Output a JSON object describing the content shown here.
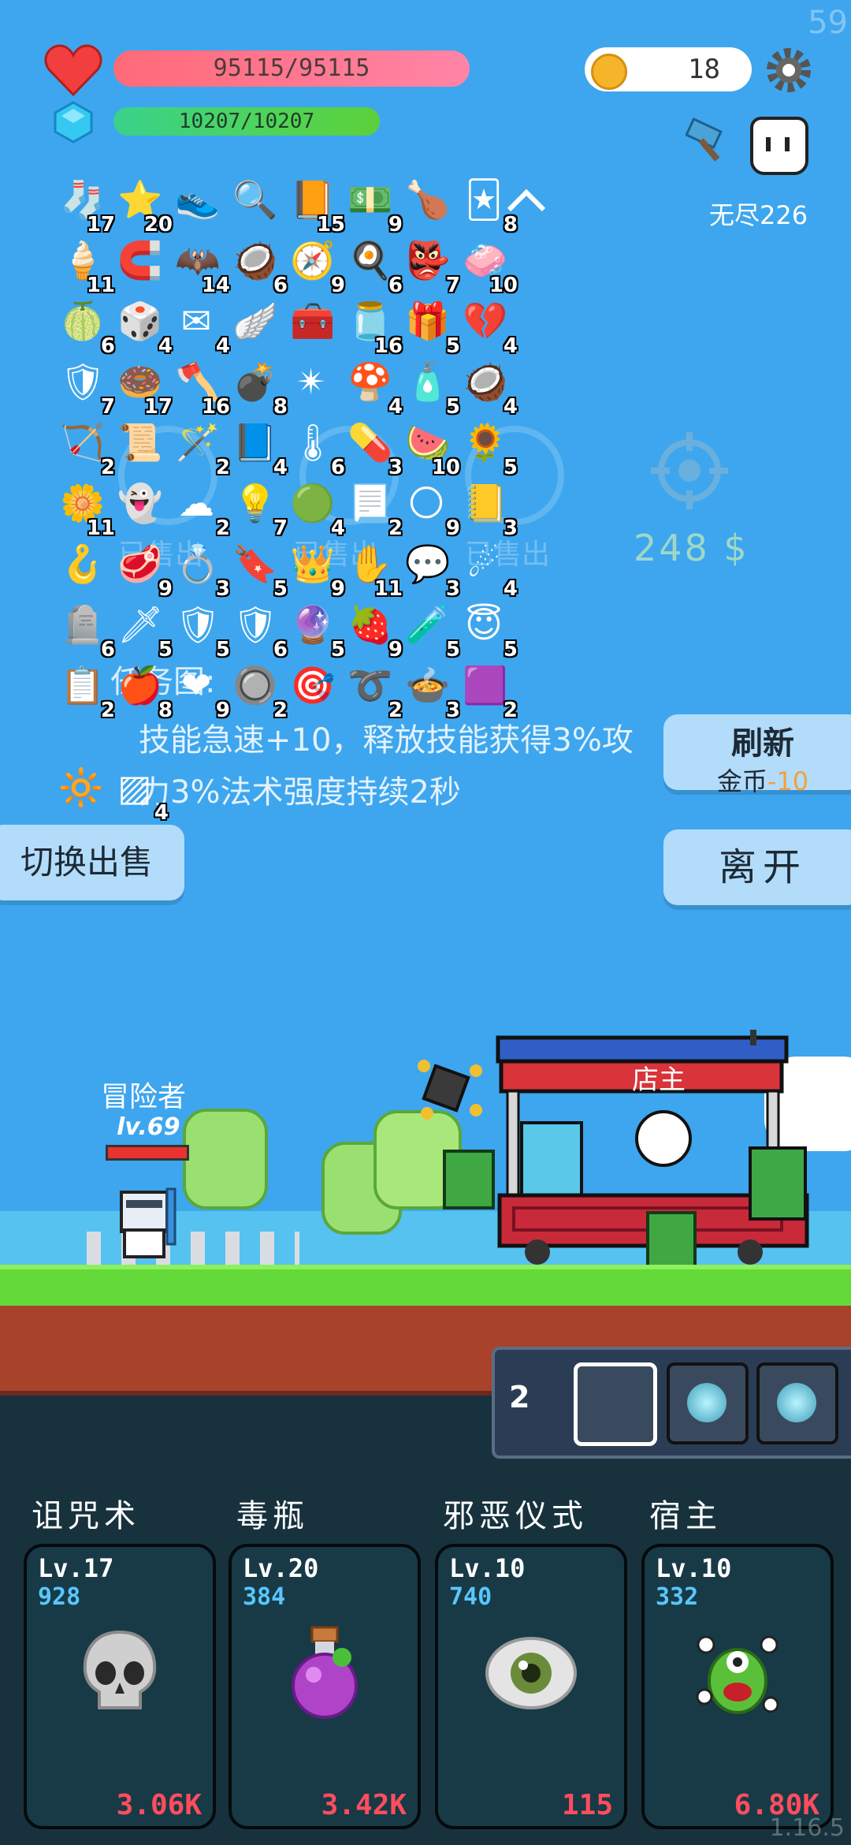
{
  "hud": {
    "fps": "59",
    "hp": "95115/95115",
    "mp": "10207/10207",
    "coins": "18",
    "mode_label": "无尽226",
    "colors": {
      "hp": "#ff6a78",
      "mp": "#4fd456",
      "accent": "#f5b52a"
    }
  },
  "items": [
    {
      "icon": "sock-icon",
      "glyph": "🧦",
      "count": "17"
    },
    {
      "icon": "star-card-icon",
      "glyph": "⭐",
      "count": "20"
    },
    {
      "icon": "sneaker-icon",
      "glyph": "👟",
      "count": ""
    },
    {
      "icon": "magnifier-icon",
      "glyph": "🔍",
      "count": ""
    },
    {
      "icon": "book-icon",
      "glyph": "📙",
      "count": "15"
    },
    {
      "icon": "cash-heart-icon",
      "glyph": "💵",
      "count": "9"
    },
    {
      "icon": "drumstick-icon",
      "glyph": "🍗",
      "count": ""
    },
    {
      "icon": "playing-cards-icon",
      "glyph": "🃏",
      "count": "8"
    },
    {
      "icon": "icecream-icon",
      "glyph": "🍦",
      "count": "11"
    },
    {
      "icon": "magnet-icon",
      "glyph": "🧲",
      "count": ""
    },
    {
      "icon": "bat-icon",
      "glyph": "🦇",
      "count": "14"
    },
    {
      "icon": "coconut-icon",
      "glyph": "🥥",
      "count": "6"
    },
    {
      "icon": "compass-icon",
      "glyph": "🧭",
      "count": "9"
    },
    {
      "icon": "egg-icon",
      "glyph": "🍳",
      "count": "6"
    },
    {
      "icon": "goblin-icon",
      "glyph": "👺",
      "count": "7"
    },
    {
      "icon": "eraser-icon",
      "glyph": "🧼",
      "count": "10"
    },
    {
      "icon": "lime-icon",
      "glyph": "🍈",
      "count": "6"
    },
    {
      "icon": "dice-icon",
      "glyph": "🎲",
      "count": "4"
    },
    {
      "icon": "envelope-icon",
      "glyph": "✉",
      "count": "4"
    },
    {
      "icon": "wing-icon",
      "glyph": "🪽",
      "count": ""
    },
    {
      "icon": "chest-icon",
      "glyph": "🧰",
      "count": ""
    },
    {
      "icon": "jam-jar-icon",
      "glyph": "🫙",
      "count": "16"
    },
    {
      "icon": "gift-icon",
      "glyph": "🎁",
      "count": "5"
    },
    {
      "icon": "broken-heart-icon",
      "glyph": "💔",
      "count": "4"
    },
    {
      "icon": "shield-icon",
      "glyph": "🛡",
      "count": "7"
    },
    {
      "icon": "donut-shield-icon",
      "glyph": "🍩",
      "count": "17"
    },
    {
      "icon": "axe-icon",
      "glyph": "🪓",
      "count": "16"
    },
    {
      "icon": "grenade-icon",
      "glyph": "💣",
      "count": "8"
    },
    {
      "icon": "spiked-ball-icon",
      "glyph": "✴",
      "count": ""
    },
    {
      "icon": "mushroom-icon",
      "glyph": "🍄",
      "count": "4"
    },
    {
      "icon": "spray-bottle-icon",
      "glyph": "🧴",
      "count": "5"
    },
    {
      "icon": "coconut-drink-icon",
      "glyph": "🥥",
      "count": "4"
    },
    {
      "icon": "bow-icon",
      "glyph": "🏹",
      "count": "2"
    },
    {
      "icon": "scroll-icon",
      "glyph": "📜",
      "count": ""
    },
    {
      "icon": "magic-wand-icon",
      "glyph": "🪄",
      "count": "2"
    },
    {
      "icon": "blue-scroll-icon",
      "glyph": "📘",
      "count": "4"
    },
    {
      "icon": "thermometer-icon",
      "glyph": "🌡",
      "count": "6"
    },
    {
      "icon": "pill-icon",
      "glyph": "💊",
      "count": "3"
    },
    {
      "icon": "watermelon-icon",
      "glyph": "🍉",
      "count": "10"
    },
    {
      "icon": "sunflower-icon",
      "glyph": "🌻",
      "count": "5"
    },
    {
      "icon": "flower-icon",
      "glyph": "🌼",
      "count": "11"
    },
    {
      "icon": "ghost-icon",
      "glyph": "👻",
      "count": ""
    },
    {
      "icon": "cloud-icon",
      "glyph": "☁",
      "count": "2"
    },
    {
      "icon": "lightbulb-icon",
      "glyph": "💡",
      "count": "7"
    },
    {
      "icon": "green-orb-icon",
      "glyph": "🟢",
      "count": "4"
    },
    {
      "icon": "parchment-icon",
      "glyph": "📃",
      "count": "2"
    },
    {
      "icon": "sun-orb-icon",
      "glyph": "🌕",
      "count": "9"
    },
    {
      "icon": "note-icon",
      "glyph": "📒",
      "count": "3"
    },
    {
      "icon": "hook-icon",
      "glyph": "🪝",
      "count": ""
    },
    {
      "icon": "meat-icon",
      "glyph": "🥩",
      "count": "9"
    },
    {
      "icon": "ring-icon",
      "glyph": "💍",
      "count": "3"
    },
    {
      "icon": "bookmark-icon",
      "glyph": "🔖",
      "count": "5"
    },
    {
      "icon": "crown-icon",
      "glyph": "👑",
      "count": "9"
    },
    {
      "icon": "hand-icon",
      "glyph": "✋",
      "count": "11"
    },
    {
      "icon": "speech-bubble-icon",
      "glyph": "💬",
      "count": "3"
    },
    {
      "icon": "meteor-icon",
      "glyph": "☄",
      "count": "4"
    },
    {
      "icon": "tombstone-icon",
      "glyph": "🪦",
      "count": "6"
    },
    {
      "icon": "sword-icon",
      "glyph": "🗡",
      "count": "5"
    },
    {
      "icon": "purple-shield-icon",
      "glyph": "🛡",
      "count": "5"
    },
    {
      "icon": "red-shield-icon",
      "glyph": "🛡",
      "count": "6"
    },
    {
      "icon": "crystal-ball-icon",
      "glyph": "🔮",
      "count": "5"
    },
    {
      "icon": "strawberry-icon",
      "glyph": "🍓",
      "count": "9"
    },
    {
      "icon": "potion-flask-icon",
      "glyph": "🧪",
      "count": "5"
    },
    {
      "icon": "halo-icon",
      "glyph": "😇",
      "count": "5"
    },
    {
      "icon": "clipboard-icon",
      "glyph": "📋",
      "count": "2"
    },
    {
      "icon": "apple-icon",
      "glyph": "🍎",
      "count": "8"
    },
    {
      "icon": "heart-icon",
      "glyph": "❤",
      "count": "9"
    },
    {
      "icon": "teal-disc-icon",
      "glyph": "🔘",
      "count": "2"
    },
    {
      "icon": "target-icon",
      "glyph": "🎯",
      "count": ""
    },
    {
      "icon": "noose-icon",
      "glyph": "➰",
      "count": "2"
    },
    {
      "icon": "cauldron-icon",
      "glyph": "🍲",
      "count": "3"
    },
    {
      "icon": "purple-box-icon",
      "glyph": "🟪",
      "count": "2"
    },
    {
      "icon": "glowing-bulb-icon",
      "glyph": "🔆",
      "count": ""
    },
    {
      "icon": "striped-block-icon",
      "glyph": "▨",
      "count": "4"
    }
  ],
  "ghost": {
    "sold1": "已售出",
    "sold2": "已售出",
    "sold3": "已售出",
    "price": "248 $",
    "desc_title": "任务图:",
    "desc_line1": "技能急速+10，释放技能获得3%攻",
    "desc_line2": "力3%法术强度持续2秒"
  },
  "buttons": {
    "refresh": "刷新",
    "refresh_cost_label": "金币",
    "refresh_cost": "-10",
    "switch_sell": "切换出售",
    "leave": "离开"
  },
  "scene": {
    "shopkeeper": "店主",
    "hero_name": "冒险者",
    "hero_level": "lv.69",
    "slot_count": "2"
  },
  "skills": [
    {
      "name": "诅咒术",
      "level": "Lv.17",
      "value": "928",
      "price": "3.06K",
      "icon": "skull-icon"
    },
    {
      "name": "毒瓶",
      "level": "Lv.20",
      "value": "384",
      "price": "3.42K",
      "icon": "poison-bottle-icon"
    },
    {
      "name": "邪恶仪式",
      "level": "Lv.10",
      "value": "740",
      "price": "115",
      "icon": "eye-icon"
    },
    {
      "name": "宿主",
      "level": "Lv.10",
      "value": "332",
      "price": "6.80K",
      "icon": "alien-host-icon"
    }
  ],
  "version": "1.16.5"
}
